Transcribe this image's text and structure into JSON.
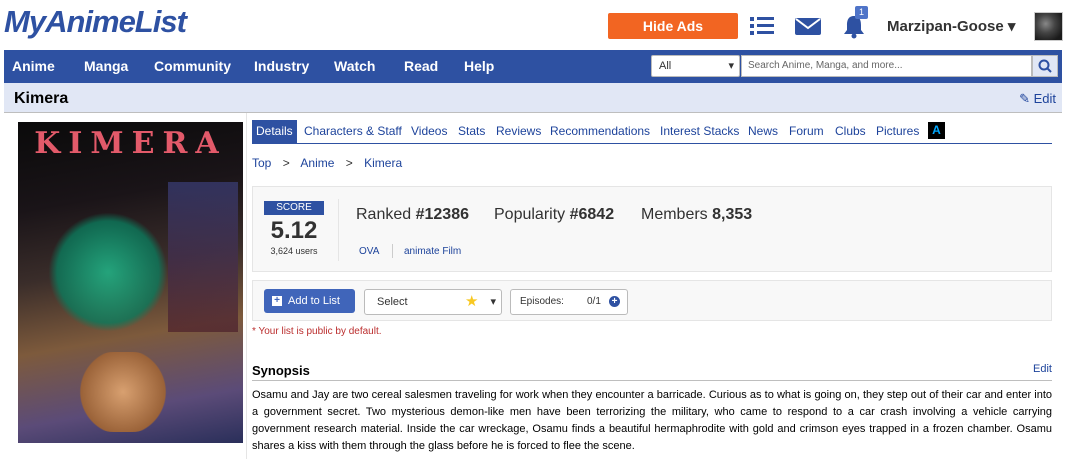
{
  "header": {
    "logo": "MyAnimeList",
    "hide_ads_label": "Hide Ads",
    "notification_count": "1",
    "username": "Marzipan-Goose",
    "username_caret": "▾"
  },
  "nav": {
    "items": [
      "Anime",
      "Manga",
      "Community",
      "Industry",
      "Watch",
      "Read",
      "Help"
    ],
    "search_type": "All",
    "search_placeholder": "Search Anime, Manga, and more..."
  },
  "title_bar": {
    "title": "Kimera",
    "edit_label": "Edit"
  },
  "cover": {
    "text": "KIMERA"
  },
  "tabs": [
    "Details",
    "Characters & Staff",
    "Videos",
    "Stats",
    "Reviews",
    "Recommendations",
    "Interest Stacks",
    "News",
    "Forum",
    "Clubs",
    "Pictures"
  ],
  "tab_icon_letter": "A",
  "breadcrumb": [
    "Top",
    "Anime",
    "Kimera"
  ],
  "breadcrumb_sep": ">",
  "stats": {
    "score_label": "SCORE",
    "score": "5.12",
    "score_users": "3,624 users",
    "ranked_label": "Ranked",
    "ranked_value": "#12386",
    "popularity_label": "Popularity",
    "popularity_value": "#6842",
    "members_label": "Members",
    "members_value": "8,353",
    "type": "OVA",
    "studio": "animate Film"
  },
  "list_controls": {
    "add_label": "Add to List",
    "status_placeholder": "Select",
    "episodes_label": "Episodes:",
    "episodes_value": "0/1",
    "public_note": "* Your list is public by default."
  },
  "synopsis": {
    "title": "Synopsis",
    "edit_label": "Edit",
    "text": "Osamu and Jay are two cereal salesmen traveling for work when they encounter a barricade. Curious as to what is going on, they step out of their car and enter into a government secret. Two mysterious demon-like men have been terrorizing the military, who came to respond to a car crash involving a vehicle carrying government research material. Inside the car wreckage, Osamu finds a beautiful hermaphrodite with gold and crimson eyes trapped in a frozen chamber. Osamu shares a kiss with them through the glass before he is forced to flee the scene."
  },
  "colors": {
    "brand": "#2e51a2",
    "hide_ads": "#f26522",
    "title_bar": "#e1e7f5",
    "link": "#1d439b"
  },
  "icons": [
    "list-icon",
    "mail-icon",
    "bell-icon",
    "search-icon",
    "pencil-icon",
    "star-icon",
    "plus-icon"
  ]
}
